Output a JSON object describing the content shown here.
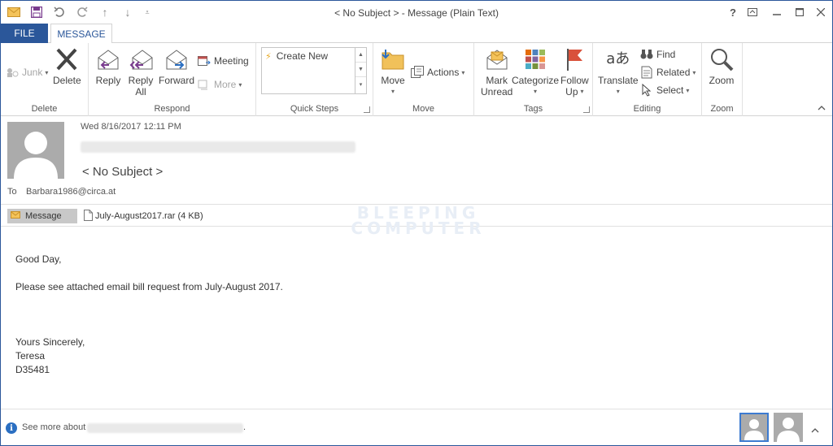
{
  "window": {
    "title": "< No Subject > - Message (Plain Text)",
    "controls": {
      "help": "?",
      "restore_ribbon": "⧉",
      "minimize": "—",
      "maximize": "☐",
      "close": "✕"
    }
  },
  "quick_access": [
    "envelope-icon",
    "save-icon",
    "undo-icon",
    "redo-icon",
    "up-arrow-icon",
    "down-arrow-icon",
    "customize-icon"
  ],
  "tabs": {
    "file": "FILE",
    "message": "MESSAGE"
  },
  "ribbon": {
    "delete_group": {
      "label": "Delete",
      "junk": "Junk",
      "delete": "Delete"
    },
    "respond_group": {
      "label": "Respond",
      "reply": "Reply",
      "reply_all_1": "Reply",
      "reply_all_2": "All",
      "forward": "Forward",
      "meeting": "Meeting",
      "more": "More"
    },
    "quick_steps_group": {
      "label": "Quick Steps",
      "create_new": "Create New"
    },
    "move_group": {
      "label": "Move",
      "move": "Move",
      "actions": "Actions"
    },
    "tags_group": {
      "label": "Tags",
      "mark_1": "Mark",
      "mark_2": "Unread",
      "categorize": "Categorize",
      "follow_1": "Follow",
      "follow_2": "Up"
    },
    "editing_group": {
      "label": "Editing",
      "translate": "Translate",
      "find": "Find",
      "related": "Related",
      "select": "Select"
    },
    "zoom_group": {
      "label": "Zoom",
      "zoom": "Zoom"
    }
  },
  "message": {
    "date": "Wed 8/16/2017 12:11 PM",
    "subject": "< No Subject >",
    "to_label": "To",
    "to": "Barbara1986@circa.at",
    "attachments": {
      "message_tab": "Message",
      "file": "July-August2017.rar (4 KB)"
    },
    "body": {
      "greeting": "Good Day,",
      "line1": "Please see attached email bill request from July-August 2017.",
      "closing": "Yours Sincerely,",
      "name": "Teresa",
      "code": "D35481"
    }
  },
  "watermark": {
    "line1": "BLEEPING",
    "line2": "COMPUTER"
  },
  "footer": {
    "see_more": "See more about",
    "dot": "."
  },
  "colors": {
    "accent": "#2b579a",
    "avatar": "#ababab"
  }
}
